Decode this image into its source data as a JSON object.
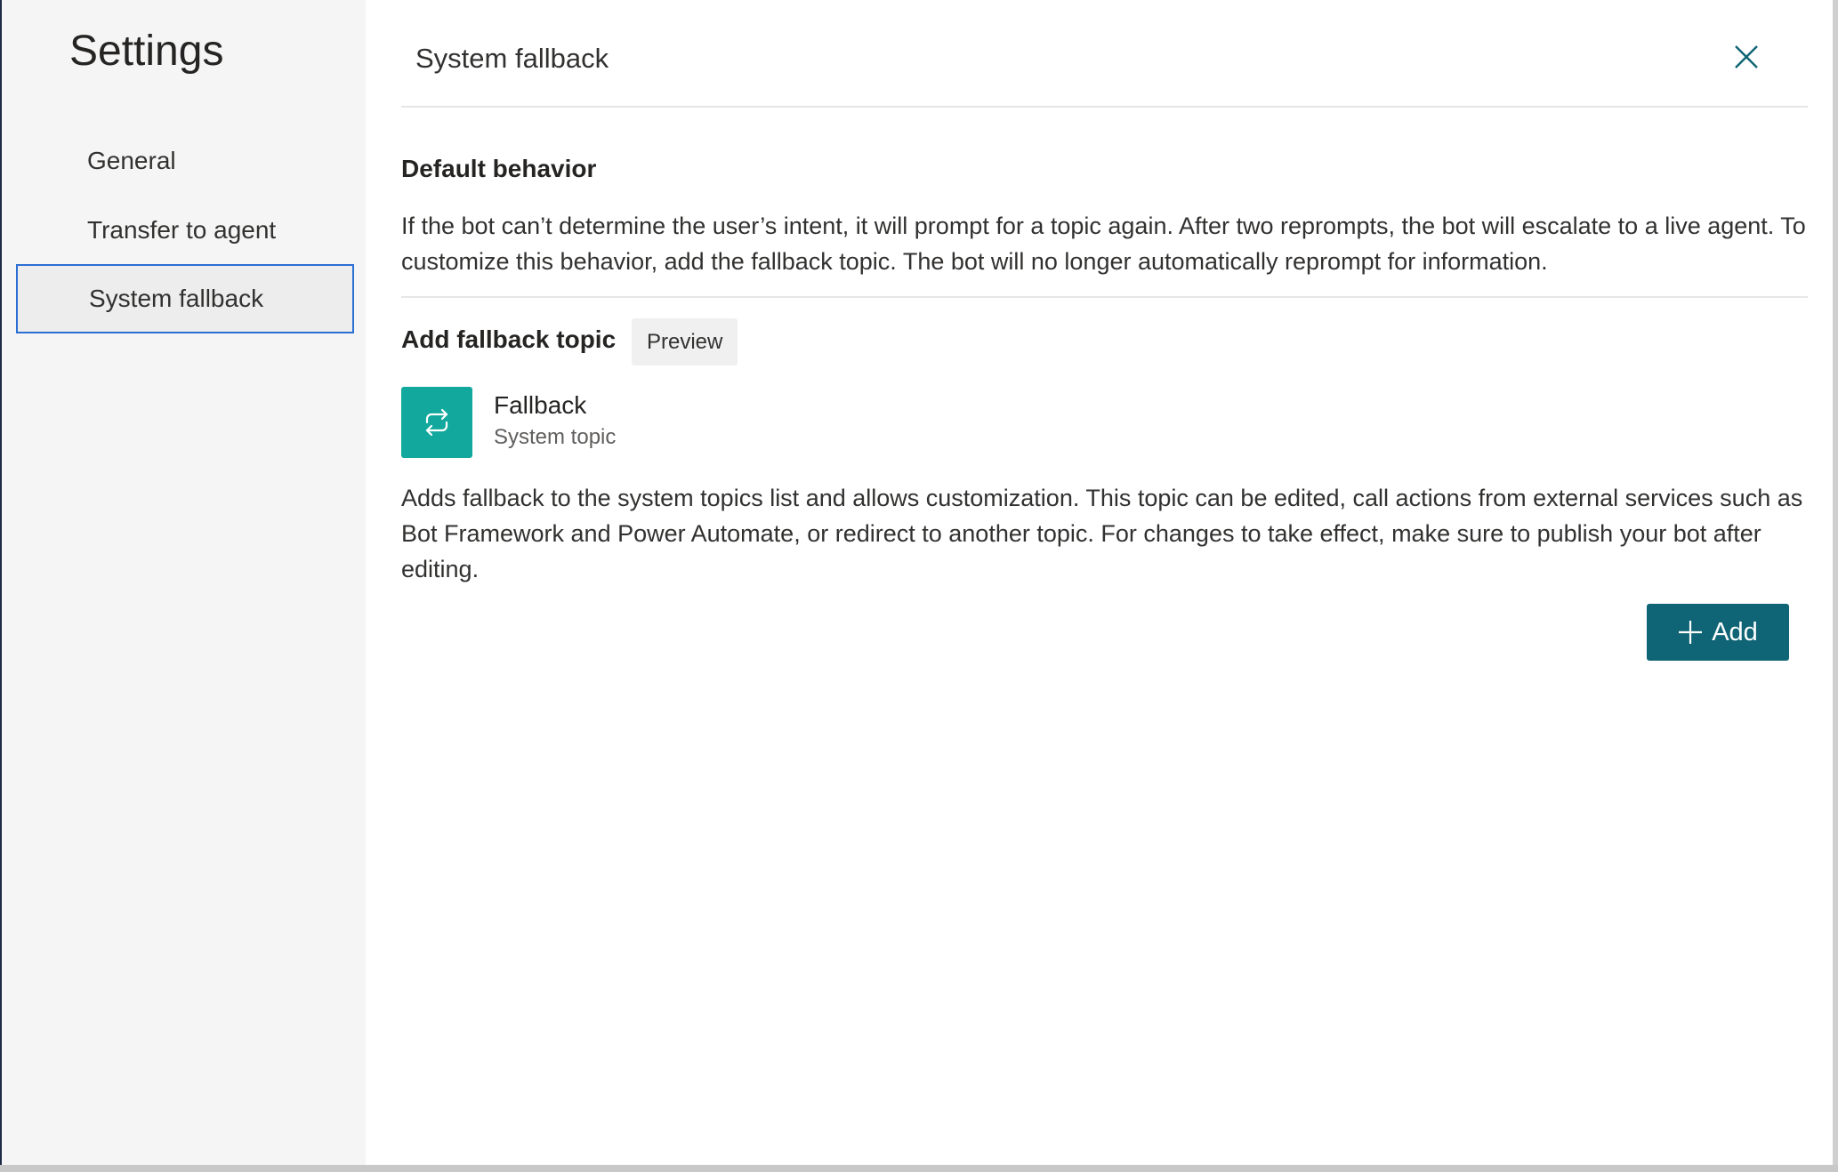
{
  "sidebar": {
    "title": "Settings",
    "items": [
      {
        "label": "General"
      },
      {
        "label": "Transfer to agent"
      },
      {
        "label": "System fallback"
      }
    ],
    "selected": "System fallback"
  },
  "header": {
    "title": "System fallback",
    "close_icon": "close-icon"
  },
  "default_behavior": {
    "heading": "Default behavior",
    "text": "If the bot can’t determine the user’s intent, it will prompt for a topic again. After two reprompts, the bot will escalate to a live agent. To customize this behavior, add the fallback topic. The bot will no longer automatically reprompt for information."
  },
  "fallback_topic": {
    "heading": "Add fallback topic",
    "badge": "Preview",
    "topic_name": "Fallback",
    "topic_type": "System topic",
    "topic_icon": "refresh-icon",
    "description": "Adds fallback to the system topics list and allows customization. This topic can be edited, call actions from external services such as Bot Framework and Power Automate, or redirect to another topic. For changes to take effect, make sure to publish your bot after editing.",
    "add_button_label": "Add",
    "add_icon": "plus-icon"
  },
  "colors": {
    "accent": "#0f6475",
    "topic_tile": "#12a89d",
    "selection_border": "#2b6fd4"
  }
}
